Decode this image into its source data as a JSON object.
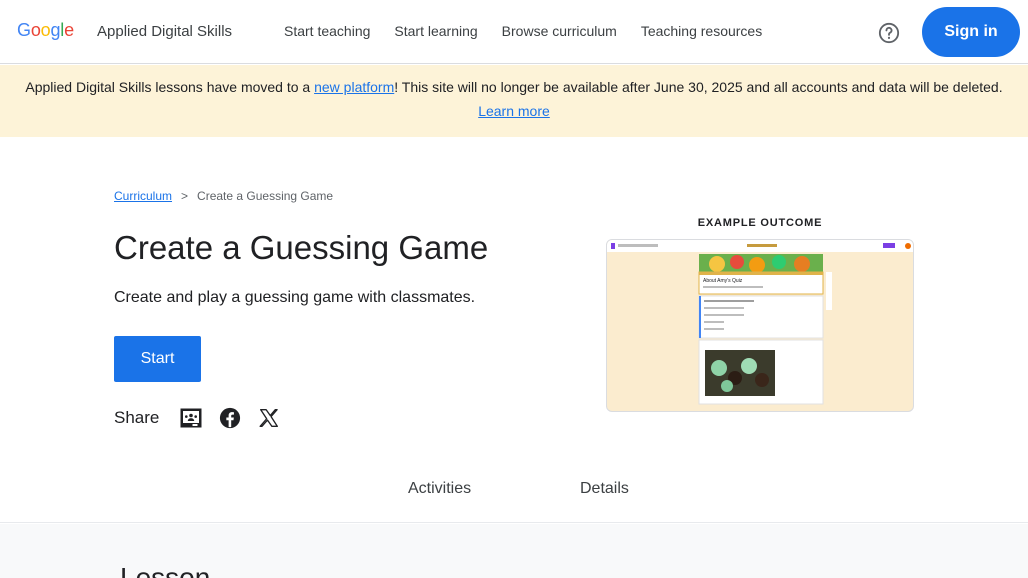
{
  "header": {
    "logo_letters": [
      {
        "ch": "G",
        "color": "#4285F4"
      },
      {
        "ch": "o",
        "color": "#EA4335"
      },
      {
        "ch": "o",
        "color": "#FBBC05"
      },
      {
        "ch": "g",
        "color": "#4285F4"
      },
      {
        "ch": "l",
        "color": "#34A853"
      },
      {
        "ch": "e",
        "color": "#EA4335"
      }
    ],
    "app_name": "Applied Digital Skills",
    "nav": [
      "Start teaching",
      "Start learning",
      "Browse curriculum",
      "Teaching resources"
    ],
    "help_icon": "help-circle-icon",
    "sign_in_label": "Sign in",
    "accent": "#1a73e8"
  },
  "banner": {
    "text_before_link": "Applied Digital Skills lessons have moved to a ",
    "link_text": "new platform",
    "text_after_link": "! This site will no longer be available after June 30, 2025 and all accounts and data will be deleted. ",
    "learn_more": "Learn more",
    "background": "#fdf3d8"
  },
  "breadcrumb": {
    "root": "Curriculum",
    "separator": ">",
    "current": "Create a Guessing Game"
  },
  "lesson": {
    "title": "Create a Guessing Game",
    "description": "Create and play a guessing game with classmates.",
    "start_label": "Start",
    "share_label": "Share",
    "share_icons": [
      "google-classroom-icon",
      "facebook-icon",
      "x-twitter-icon"
    ]
  },
  "example": {
    "label": "EXAMPLE OUTCOME",
    "form_title": "About Amy's Quiz"
  },
  "tabs": [
    "Activities",
    "Details"
  ],
  "lower": {
    "heading": "Lesson"
  }
}
